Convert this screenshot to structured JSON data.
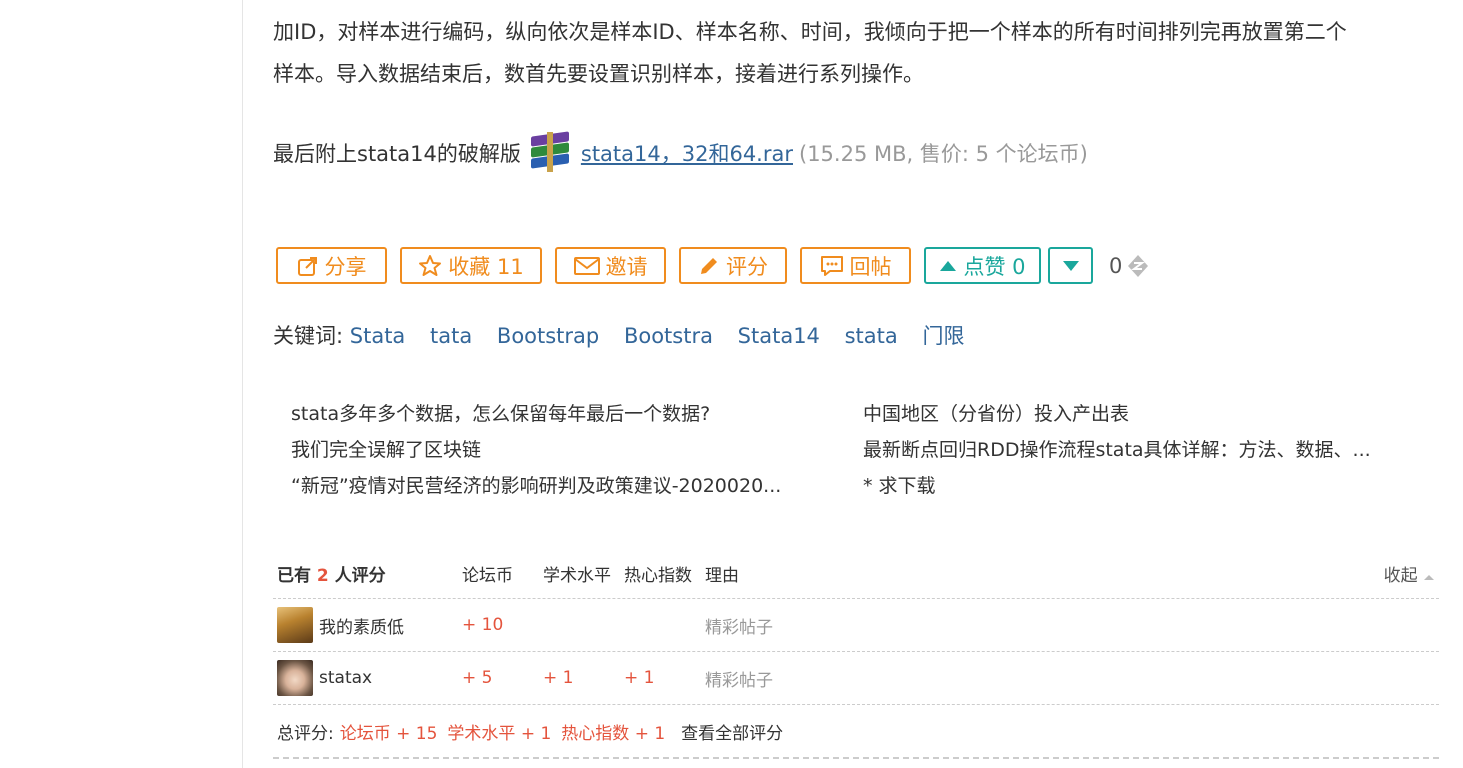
{
  "article": {
    "line1": "加ID，对样本进行编码，纵向依次是样本ID、样本名称、时间，我倾向于把一个样本的所有时间排列完再放置第二个",
    "line2": "样本。导入数据结束后，数首先要设置识别样本，接着进行系列操作。",
    "attach_prefix": "最后附上stata14的破解版",
    "attach_name": "stata14，32和64.rar",
    "attach_meta": "(15.25 MB, 售价: 5 个论坛币)"
  },
  "actions": {
    "share": "分享",
    "favorite": "收藏 11",
    "invite": "邀请",
    "rate": "评分",
    "reply": "回帖",
    "like": "点赞 0",
    "coin_count": "0"
  },
  "keywords": {
    "label": "关键词:",
    "items": [
      "Stata",
      "tata",
      "Bootstrap",
      "Bootstra",
      "Stata14",
      "stata",
      "门限"
    ]
  },
  "related": {
    "left": [
      "stata多年多个数据，怎么保留每年最后一个数据?",
      "我们完全误解了区块链",
      "“新冠”疫情对民营经济的影响研判及政策建议-2020020..."
    ],
    "right": [
      "中国地区（分省份）投入产出表",
      "最新断点回归RDD操作流程stata具体详解：方法、数据、...",
      "* 求下载"
    ]
  },
  "rating": {
    "header_prefix": "已有",
    "header_count": "2",
    "header_suffix": "人评分",
    "col_coin": "论坛币",
    "col_academic": "学术水平",
    "col_enthusiasm": "热心指数",
    "col_reason": "理由",
    "collapse": "收起",
    "rows": [
      {
        "user": "我的素质低",
        "coin": "+ 10",
        "academic": "",
        "enthusiasm": "",
        "reason": "精彩帖子"
      },
      {
        "user": "statax",
        "coin": "+ 5",
        "academic": "+ 1",
        "enthusiasm": "+ 1",
        "reason": "精彩帖子"
      }
    ],
    "total_label": "总评分:",
    "total_coin": "论坛币 + 15",
    "total_academic": "学术水平 + 1",
    "total_enthusiasm": "热心指数 + 1",
    "view_all": "查看全部评分"
  },
  "colors": {
    "accent_orange": "#f08c1e",
    "accent_teal": "#1aa79c",
    "link_blue": "#336699",
    "score_red": "#e4543d"
  }
}
